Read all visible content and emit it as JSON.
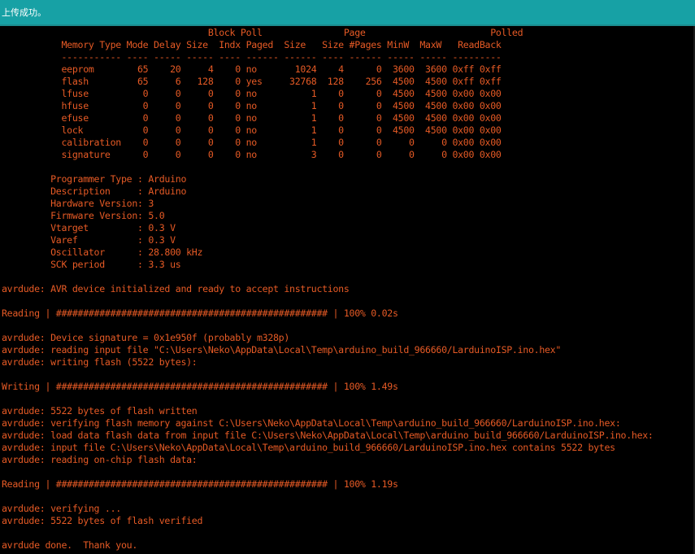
{
  "status_bar": {
    "message": "上传成功。"
  },
  "console": {
    "lines": [
      "                                      Block Poll               Page                       Polled",
      "           Memory Type Mode Delay Size  Indx Paged  Size   Size #Pages MinW  MaxW   ReadBack",
      "           ----------- ---- ----- ----- ---- ------ ------ ---- ------ ----- ----- ---------",
      "           eeprom        65    20     4    0 no       1024    4      0  3600  3600 0xff 0xff",
      "           flash         65     6   128    0 yes     32768  128    256  4500  4500 0xff 0xff",
      "           lfuse          0     0     0    0 no          1    0      0  4500  4500 0x00 0x00",
      "           hfuse          0     0     0    0 no          1    0      0  4500  4500 0x00 0x00",
      "           efuse          0     0     0    0 no          1    0      0  4500  4500 0x00 0x00",
      "           lock           0     0     0    0 no          1    0      0  4500  4500 0x00 0x00",
      "           calibration    0     0     0    0 no          1    0      0     0     0 0x00 0x00",
      "           signature      0     0     0    0 no          3    0      0     0     0 0x00 0x00",
      "",
      "         Programmer Type : Arduino",
      "         Description     : Arduino",
      "         Hardware Version: 3",
      "         Firmware Version: 5.0",
      "         Vtarget         : 0.3 V",
      "         Varef           : 0.3 V",
      "         Oscillator      : 28.800 kHz",
      "         SCK period      : 3.3 us",
      "",
      "avrdude: AVR device initialized and ready to accept instructions",
      "",
      "Reading | ################################################## | 100% 0.02s",
      "",
      "avrdude: Device signature = 0x1e950f (probably m328p)",
      "avrdude: reading input file \"C:\\Users\\Neko\\AppData\\Local\\Temp\\arduino_build_966660/LarduinoISP.ino.hex\"",
      "avrdude: writing flash (5522 bytes):",
      "",
      "Writing | ################################################## | 100% 1.49s",
      "",
      "avrdude: 5522 bytes of flash written",
      "avrdude: verifying flash memory against C:\\Users\\Neko\\AppData\\Local\\Temp\\arduino_build_966660/LarduinoISP.ino.hex:",
      "avrdude: load data flash data from input file C:\\Users\\Neko\\AppData\\Local\\Temp\\arduino_build_966660/LarduinoISP.ino.hex:",
      "avrdude: input file C:\\Users\\Neko\\AppData\\Local\\Temp\\arduino_build_966660/LarduinoISP.ino.hex contains 5522 bytes",
      "avrdude: reading on-chip flash data:",
      "",
      "Reading | ################################################## | 100% 1.19s",
      "",
      "avrdude: verifying ...",
      "avrdude: 5522 bytes of flash verified",
      "",
      "avrdude done.  Thank you."
    ]
  }
}
